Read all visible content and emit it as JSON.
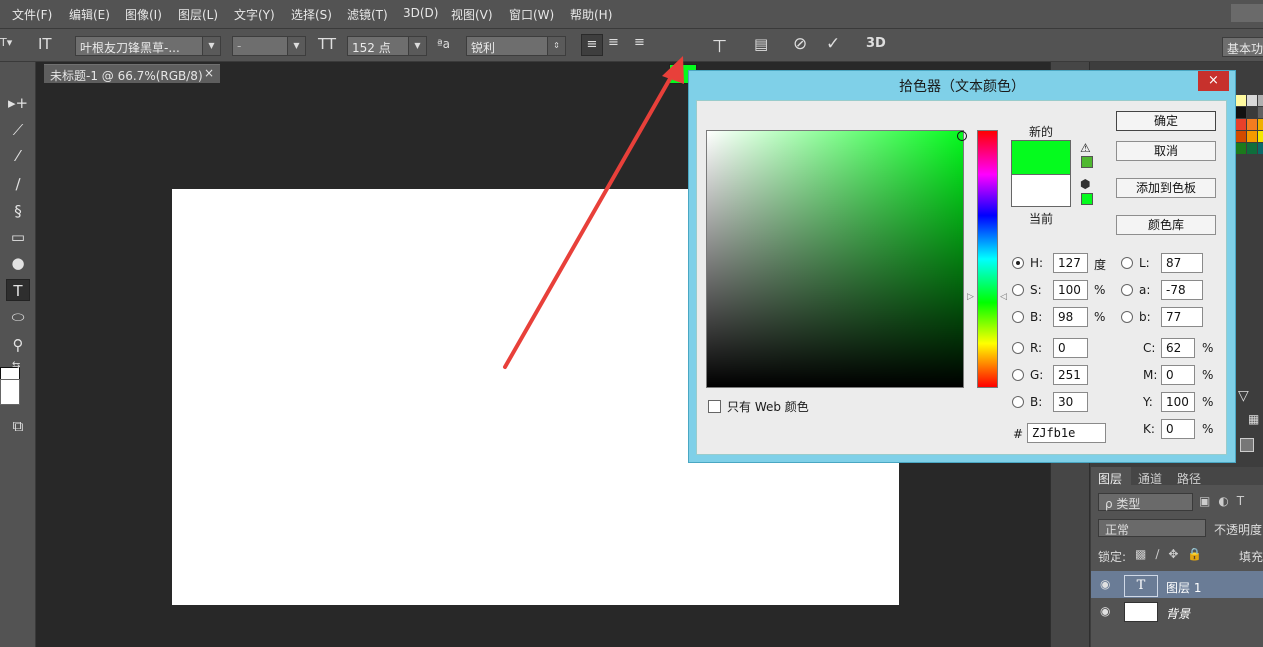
{
  "menubar": {
    "items": [
      "文件(F)",
      "编辑(E)",
      "图像(I)",
      "图层(L)",
      "文字(Y)",
      "选择(S)",
      "滤镜(T)",
      "3D(D)",
      "视图(V)",
      "窗口(W)",
      "帮助(H)"
    ]
  },
  "options": {
    "font_family": "叶根友刀锋黑草-...",
    "font_style": "-",
    "font_size": "152 点",
    "aa_label": "ªa",
    "antialias": "锐利",
    "text_color": "#05fb1e",
    "workspace": "基本功"
  },
  "document": {
    "tab_title": "未标题-1 @ 66.7%(RGB/8)",
    "close_glyph": "×"
  },
  "picker": {
    "title": "拾色器（文本颜色）",
    "close_glyph": "×",
    "new_label": "新的",
    "current_label": "当前",
    "new_color": "#05fb1e",
    "current_color": "#ffffff",
    "buttons": {
      "ok": "确定",
      "cancel": "取消",
      "add_swatch": "添加到色板",
      "color_libraries": "颜色库"
    },
    "web_only_label": "只有 Web 颜色",
    "hsb": {
      "h": {
        "label": "H:",
        "value": "127",
        "unit": "度"
      },
      "s": {
        "label": "S:",
        "value": "100",
        "unit": "%"
      },
      "b": {
        "label": "B:",
        "value": "98",
        "unit": "%"
      }
    },
    "rgb": {
      "r": {
        "label": "R:",
        "value": "0"
      },
      "g": {
        "label": "G:",
        "value": "251"
      },
      "b": {
        "label": "B:",
        "value": "30"
      }
    },
    "lab": {
      "l": {
        "label": "L:",
        "value": "87"
      },
      "a": {
        "label": "a:",
        "value": "-78"
      },
      "b": {
        "label": "b:",
        "value": "77"
      }
    },
    "cmyk": {
      "c": {
        "label": "C:",
        "value": "62",
        "unit": "%"
      },
      "m": {
        "label": "M:",
        "value": "0",
        "unit": "%"
      },
      "y": {
        "label": "Y:",
        "value": "100",
        "unit": "%"
      },
      "k": {
        "label": "K:",
        "value": "0",
        "unit": "%"
      }
    },
    "hex_label": "#",
    "hex_value": "ZJfb1e"
  },
  "layers": {
    "tabs": [
      "图层",
      "通道",
      "路径"
    ],
    "filter_kind": "ρ 类型",
    "blend_mode": "正常",
    "opacity_label": "不透明度",
    "lock_label": "锁定:",
    "fill_label": "填充",
    "items": [
      {
        "name": "图层 1",
        "type_glyph": "T"
      },
      {
        "name": "背景"
      }
    ]
  },
  "annotation": {
    "arrow_color": "#e8403a"
  },
  "swatch_colors": [
    "#fffaa0",
    "#d9d9d9",
    "#b0b0b0",
    "#8c8c8c",
    "#111111",
    "#3a3a3a",
    "#616161",
    "#858585",
    "#e8402a",
    "#f47c20",
    "#f0b000",
    "#bce000",
    "#d24a00",
    "#f59a00",
    "#f3e800",
    "#4ea832",
    "#1c7a1c",
    "#0f6e3c",
    "#0a6a6a",
    "#0a5a82"
  ]
}
